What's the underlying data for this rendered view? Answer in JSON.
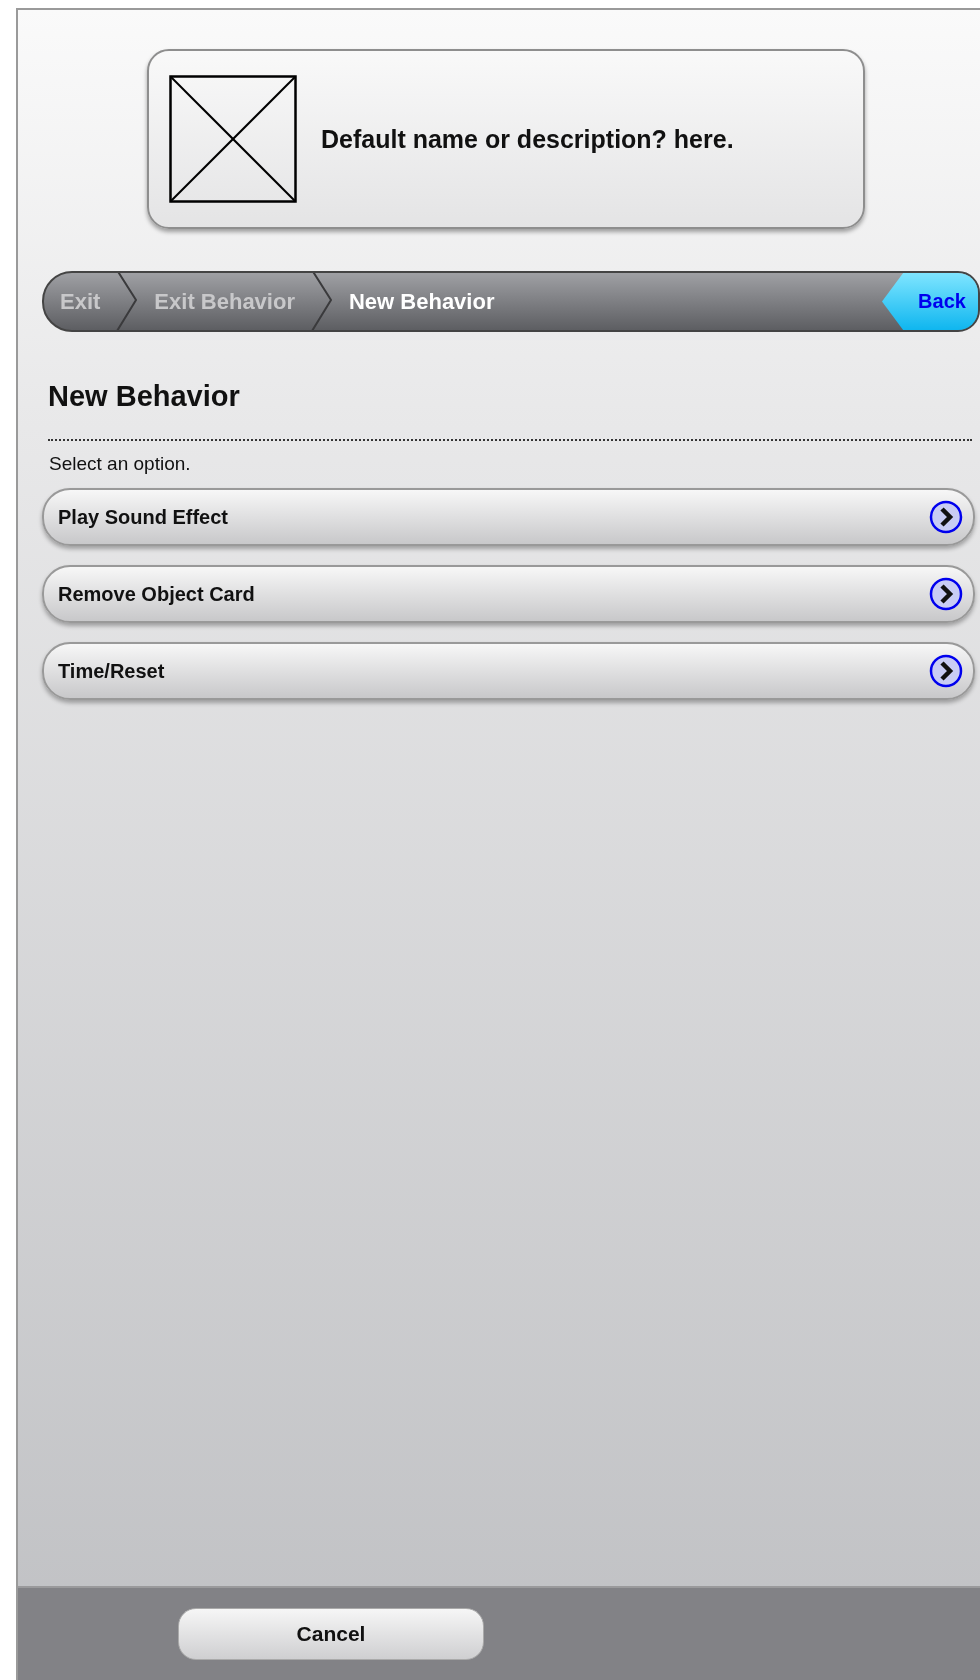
{
  "header": {
    "title": "Default name or description? here."
  },
  "breadcrumb": {
    "items": [
      {
        "label": "Exit",
        "selected": false
      },
      {
        "label": "Exit Behavior",
        "selected": false
      },
      {
        "label": "New Behavior",
        "selected": true
      }
    ],
    "back": "Back"
  },
  "page": {
    "title": "New Behavior",
    "instruction": "Select an option."
  },
  "options": [
    {
      "label": "Play Sound Effect"
    },
    {
      "label": "Remove Object Card"
    },
    {
      "label": "Time/Reset"
    }
  ],
  "footer": {
    "cancel": "Cancel"
  }
}
